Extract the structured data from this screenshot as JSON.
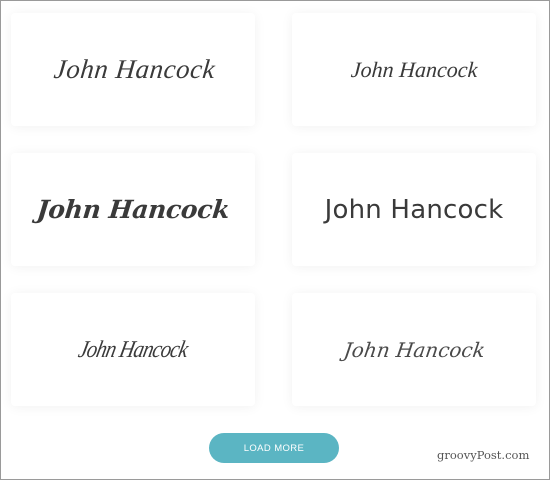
{
  "signatures": [
    {
      "name": "John Hancock"
    },
    {
      "name": "John Hancock"
    },
    {
      "name": "John Hancock"
    },
    {
      "name": "John Hancock"
    },
    {
      "name": "John Hancock"
    },
    {
      "name": "John Hancock"
    }
  ],
  "actions": {
    "load_more_label": "LOAD MORE"
  },
  "watermark": {
    "text": "groovyPost.com"
  },
  "colors": {
    "accent": "#5bb5c3",
    "signature_ink": "#3a3a3a",
    "card_background": "#ffffff"
  }
}
